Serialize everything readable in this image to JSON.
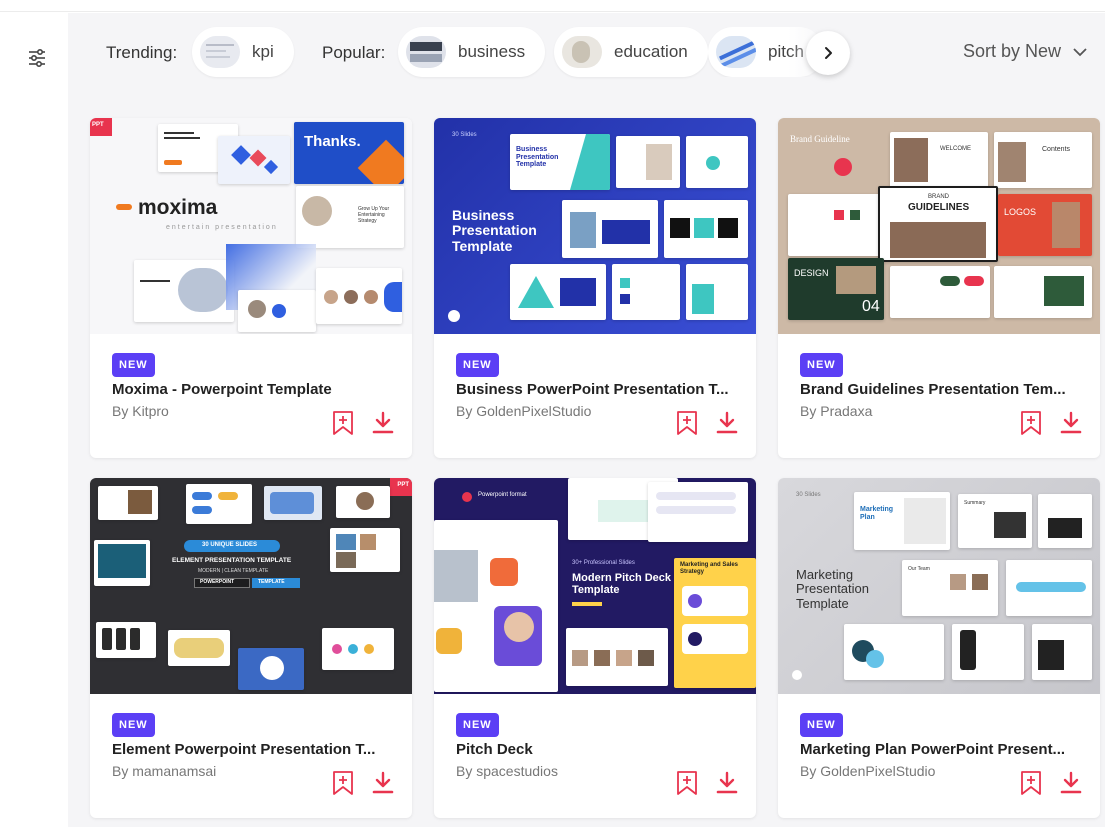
{
  "filterbar": {
    "trending_label": "Trending:",
    "popular_label": "Popular:",
    "trending_chips": [
      {
        "label": "kpi"
      }
    ],
    "popular_chips": [
      {
        "label": "business"
      },
      {
        "label": "education"
      },
      {
        "label": "pitch"
      }
    ],
    "sort_label": "Sort by New"
  },
  "icons": {
    "sidebar": "sliders-icon",
    "next": "chevron-right-icon",
    "sort": "chevron-down-icon",
    "save": "bookmark-plus-icon",
    "download": "download-icon"
  },
  "colors": {
    "accent": "#e8344e",
    "badge": "#5b3ff5",
    "background": "#f5f5f7"
  },
  "cards": [
    {
      "badge": "NEW",
      "title": "Moxima - Powerpoint Template",
      "author": "By Kitpro",
      "cover": {
        "brand": "moxima",
        "subtitle": "entertain presentation",
        "thanks": "Thanks.",
        "ppt": "PPT",
        "side_text": "Grow Up Your Entertaining Strategy"
      }
    },
    {
      "badge": "NEW",
      "title": "Business PowerPoint Presentation T...",
      "author": "By GoldenPixelStudio",
      "cover": {
        "count": "30 Slides",
        "heading": "Business Presentation Template",
        "slide_heading": "Business Presentation Template"
      }
    },
    {
      "badge": "NEW",
      "title": "Brand Guidelines Presentation Tem...",
      "author": "By Pradaxa",
      "cover": {
        "top": "Brand Guideline",
        "center_small": "BRAND",
        "center": "GUIDELINES",
        "welcome": "WELCOME",
        "contents": "Contents",
        "logos": "LOGOS",
        "design": "DESIGN",
        "num": "04"
      }
    },
    {
      "badge": "NEW",
      "title": "Element Powerpoint Presentation T...",
      "author": "By mamanamsai",
      "cover": {
        "unique": "30 UNIQUE SLIDES",
        "heading": "ELEMENT PRESENTATION TEMPLATE",
        "sub": "MODERN | CLEAN TEMPLATE",
        "pill1": "POWERPOINT",
        "pill2": "TEMPLATE",
        "ppt": "PPT"
      }
    },
    {
      "badge": "NEW",
      "title": "Pitch Deck",
      "author": "By spacestudios",
      "cover": {
        "format": "Powerpoint format",
        "count": "30+ Professional Slides",
        "heading": "Modern Pitch Deck Template",
        "strategy": "Marketing and Sales Strategy"
      }
    },
    {
      "badge": "NEW",
      "title": "Marketing Plan PowerPoint Present...",
      "author": "By GoldenPixelStudio",
      "cover": {
        "count": "30 Slides",
        "heading": "Marketing Presentation Template",
        "slide_heading": "Marketing Plan",
        "summary": "Summary",
        "team": "Our Team"
      }
    }
  ]
}
